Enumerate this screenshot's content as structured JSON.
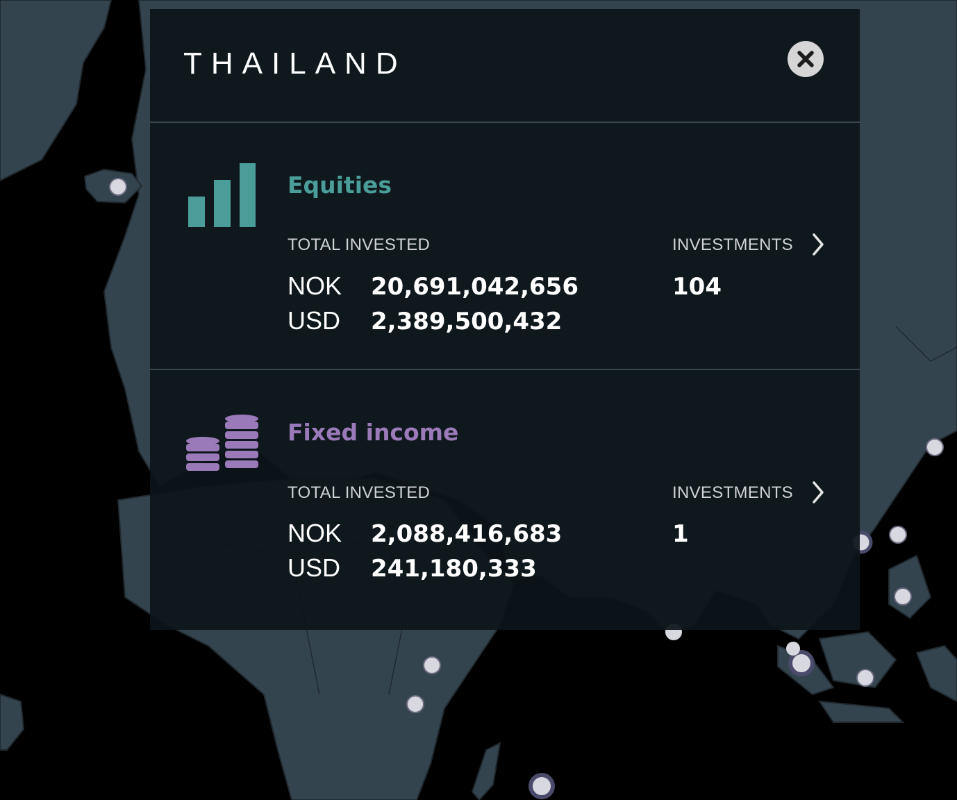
{
  "panel": {
    "country": "THAILAND",
    "close_icon": "close-icon"
  },
  "equities": {
    "title": "Equities",
    "color": "#4a9d98",
    "icon": "bar-chart-icon",
    "total_invested_label": "TOTAL INVESTED",
    "investments_label": "INVESTMENTS",
    "rows": [
      {
        "currency": "NOK",
        "value": "20,691,042,656"
      },
      {
        "currency": "USD",
        "value": "2,389,500,432"
      }
    ],
    "investments_count": "104"
  },
  "fixed_income": {
    "title": "Fixed income",
    "color": "#9a7ab8",
    "icon": "coin-stacks-icon",
    "total_invested_label": "TOTAL INVESTED",
    "investments_label": "INVESTMENTS",
    "rows": [
      {
        "currency": "NOK",
        "value": "2,088,416,683"
      },
      {
        "currency": "USD",
        "value": "241,180,333"
      }
    ],
    "investments_count": "1"
  },
  "map": {
    "land_color": "#34444f",
    "ocean_color": "#000000",
    "marker_color": "#e8e8ee"
  }
}
